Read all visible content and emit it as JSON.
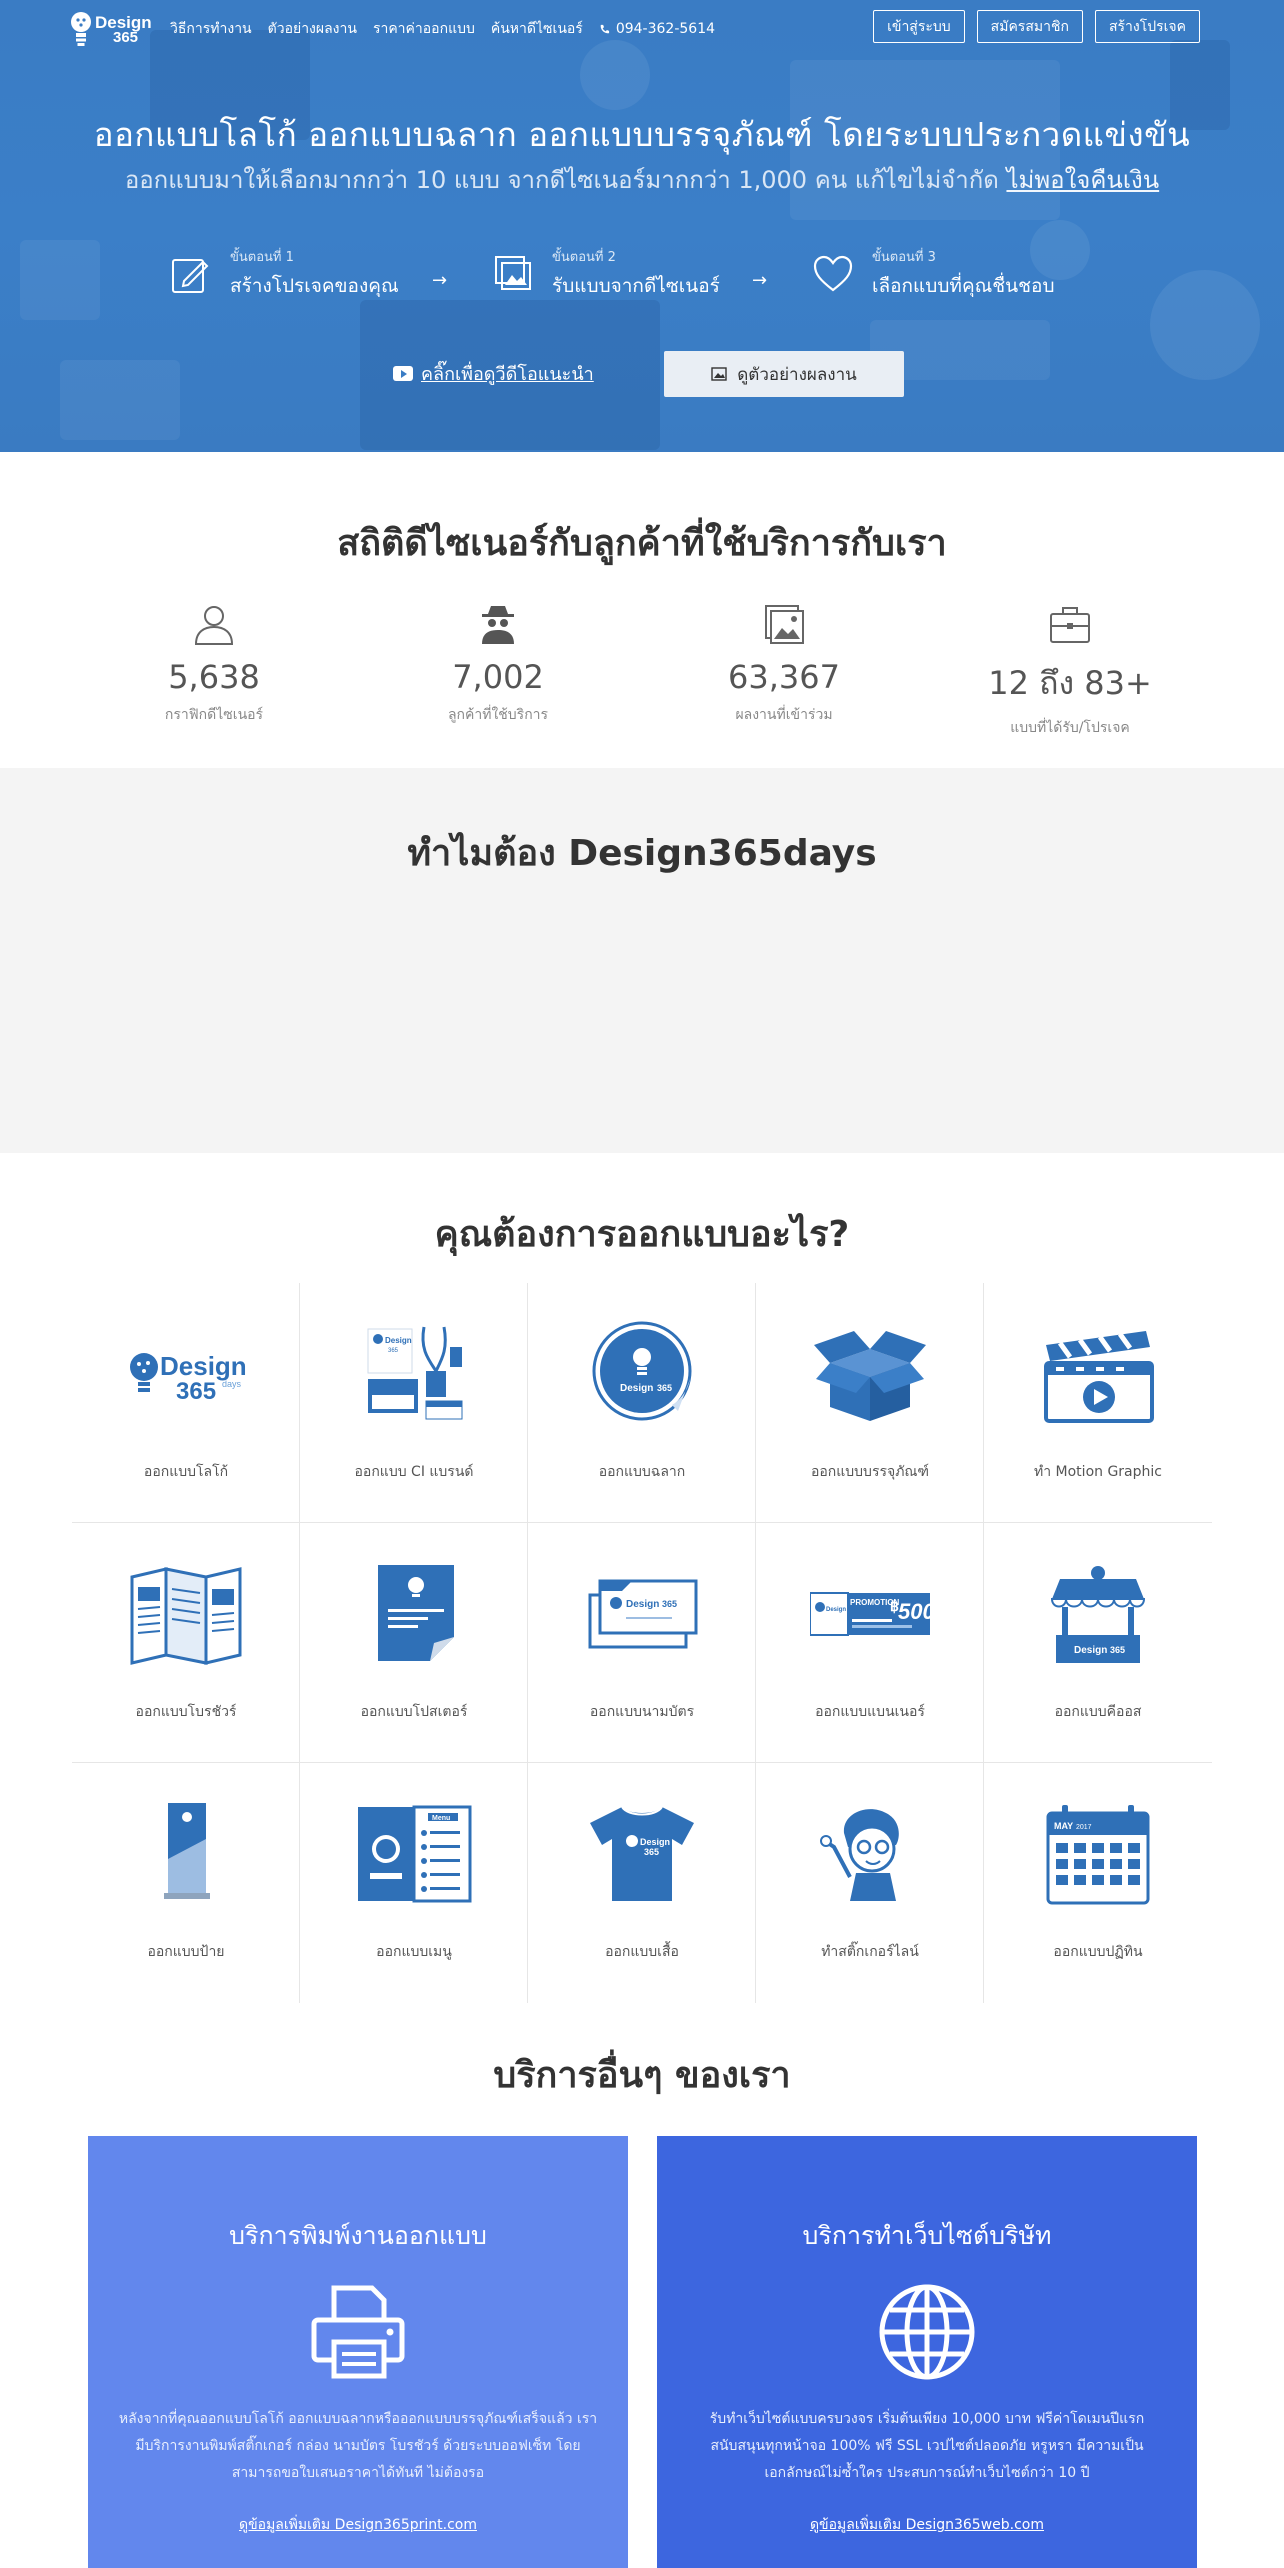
{
  "colors": {
    "hero_bg": "#3a7cc4",
    "brand_blue": "#2f70b7",
    "card_print": "#6287ed",
    "card_web": "#3d66df",
    "why_bg": "#f4f4f4"
  },
  "nav": {
    "logo": "Design 365",
    "links": [
      "วิธีการทำงาน",
      "ตัวอย่างผลงาน",
      "ราคาค่าออกแบบ",
      "ค้นหาดีไซเนอร์"
    ],
    "phone": "094-362-5614",
    "phone_icon": "phone-icon",
    "buttons": [
      "เข้าสู่ระบบ",
      "สมัครสมาชิก",
      "สร้างโปรเจค"
    ]
  },
  "hero": {
    "title": "ออกแบบโลโก้ ออกแบบฉลาก ออกแบบบรรจุภัณฑ์ โดยระบบประกวดแข่งขัน",
    "subtitle": "ออกแบบมาให้เลือกมากกว่า 10 แบบ จากดีไซเนอร์มากกว่า 1,000 คน แก้ไขไม่จำกัด",
    "subtitle_link": "ไม่พอใจคืนเงิน",
    "steps": [
      {
        "num": "ขั้นตอนที่ 1",
        "text": "สร้างโปรเจคของคุณ",
        "icon": "pencil-icon"
      },
      {
        "num": "ขั้นตอนที่ 2",
        "text": "รับแบบจากดีไซเนอร์",
        "icon": "images-icon"
      },
      {
        "num": "ขั้นตอนที่ 3",
        "text": "เลือกแบบที่คุณชื่นชอบ",
        "icon": "heart-icon"
      }
    ],
    "video_link": "คลิ๊กเพื่อดูวีดีโอแนะนำ",
    "sample_button": "ดูตัวอย่างผลงาน"
  },
  "stats": {
    "title": "สถิติดีไซเนอร์กับลูกค้าที่ใช้บริการกับเรา",
    "items": [
      {
        "value": "5,638",
        "label": "กราฟิกดีไซเนอร์",
        "icon": "user-icon"
      },
      {
        "value": "7,002",
        "label": "ลูกค้าที่ใช้บริการ",
        "icon": "spy-icon"
      },
      {
        "value": "63,367",
        "label": "ผลงานที่เข้าร่วม",
        "icon": "image-icon"
      },
      {
        "value": "12 ถึง 83+",
        "label": "แบบที่ได้รับ/โปรเจค",
        "icon": "briefcase-icon"
      }
    ]
  },
  "why": {
    "title": "ทำไมต้อง Design365days"
  },
  "design": {
    "title": "คุณต้องการออกแบบอะไร?",
    "items": [
      {
        "label": "ออกแบบโลโก้",
        "art": "logo-art"
      },
      {
        "label": "ออกแบบ CI แบรนด์",
        "art": "ci-brand-art"
      },
      {
        "label": "ออกแบบฉลาก",
        "art": "label-sticker-art"
      },
      {
        "label": "ออกแบบบรรจุภัณฑ์",
        "art": "box-art"
      },
      {
        "label": "ทำ Motion Graphic",
        "art": "clapper-art"
      },
      {
        "label": "ออกแบบโบรชัวร์",
        "art": "brochure-art"
      },
      {
        "label": "ออกแบบโปสเตอร์",
        "art": "poster-art"
      },
      {
        "label": "ออกแบบนามบัตร",
        "art": "namecard-art"
      },
      {
        "label": "ออกแบบแบนเนอร์",
        "art": "banner-art"
      },
      {
        "label": "ออกแบบคีออส",
        "art": "kiosk-art"
      },
      {
        "label": "ออกแบบป้าย",
        "art": "rollup-art"
      },
      {
        "label": "ออกแบบเมนู",
        "art": "menu-art"
      },
      {
        "label": "ออกแบบเสื้อ",
        "art": "tshirt-art"
      },
      {
        "label": "ทำสติ๊กเกอร์ไลน์",
        "art": "line-sticker-art"
      },
      {
        "label": "ออกแบบปฏิทิน",
        "art": "calendar-art"
      }
    ],
    "art_text": {
      "brand": "Design",
      "brand_num": "365",
      "brand_days": "days",
      "promo": "PROMOTION",
      "promo_price": "500",
      "menu": "Menu",
      "cal_month": "MAY",
      "cal_year": "2017"
    }
  },
  "others": {
    "title": "บริการอื่นๆ ของเรา",
    "cards": [
      {
        "title": "บริการพิมพ์งานออกแบบ",
        "icon": "printer-icon",
        "desc": "หลังจากที่คุณออกแบบโลโก้ ออกแบบฉลากหรือออกแบบบรรจุภัณฑ์เสร็จแล้ว เรามีบริการงานพิมพ์สติ๊กเกอร์ กล่อง นามบัตร โบรชัวร์ ด้วยระบบออฟเซ็ท โดยสามารถขอใบเสนอราคาได้ทันที ไม่ต้องรอ",
        "link": "ดูข้อมูลเพิ่มเติม Design365print.com"
      },
      {
        "title": "บริการทำเว็บไซต์บริษัท",
        "icon": "globe-icon",
        "desc": "รับทำเว็บไซต์แบบครบวงจร เริ่มต้นเพียง 10,000 บาท ฟรีค่าโดเมนปีแรก สนับสนุนทุกหน้าจอ 100% ฟรี SSL เวปไซต์ปลอดภัย หรูหรา มีความเป็นเอกลักษณ์ไม่ซ้ำใคร ประสบการณ์ทำเว็บไซต์กว่า 10 ปี",
        "link": "ดูข้อมูลเพิ่มเติม Design365web.com"
      }
    ]
  }
}
